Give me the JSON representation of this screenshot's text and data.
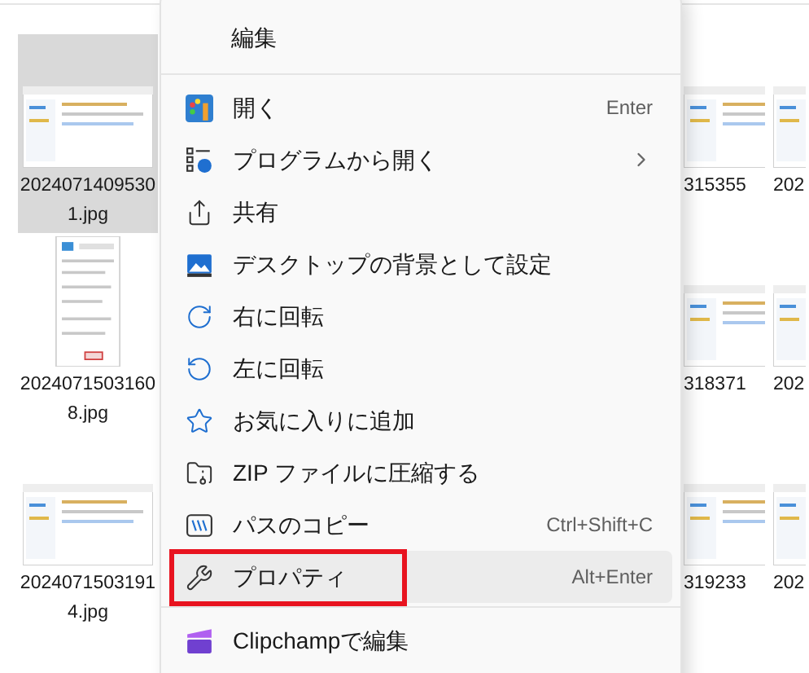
{
  "files": {
    "left": [
      {
        "lines": [
          "2024071409530",
          "1.jpg"
        ],
        "selected": true
      },
      {
        "lines": [
          "2024071503160",
          "8.jpg"
        ],
        "selected": false
      },
      {
        "lines": [
          "2024071503191",
          "4.jpg"
        ],
        "selected": false
      }
    ],
    "right": [
      {
        "lines": [
          "315355"
        ],
        "selected": false
      },
      {
        "lines": [
          "318371"
        ],
        "selected": false
      },
      {
        "lines": [
          "319233"
        ],
        "selected": false
      }
    ],
    "far_right": [
      {
        "lines": [
          "202"
        ],
        "selected": false
      },
      {
        "lines": [
          "202"
        ],
        "selected": false
      },
      {
        "lines": [
          "202"
        ],
        "selected": false
      }
    ]
  },
  "context_menu": {
    "items": [
      {
        "kind": "header",
        "label": "編集"
      },
      {
        "kind": "separator"
      },
      {
        "kind": "item",
        "label": "開く",
        "shortcut": "Enter",
        "hovered": false,
        "annotated": false
      },
      {
        "kind": "item",
        "label": "プログラムから開く",
        "submenu": true,
        "hovered": false,
        "annotated": false
      },
      {
        "kind": "item",
        "label": "共有",
        "hovered": false,
        "annotated": false
      },
      {
        "kind": "item",
        "label": "デスクトップの背景として設定",
        "hovered": false,
        "annotated": false
      },
      {
        "kind": "item",
        "label": "右に回転",
        "hovered": false,
        "annotated": false
      },
      {
        "kind": "item",
        "label": "左に回転",
        "hovered": false,
        "annotated": false
      },
      {
        "kind": "item",
        "label": "お気に入りに追加",
        "hovered": false,
        "annotated": false
      },
      {
        "kind": "item",
        "label": "ZIP ファイルに圧縮する",
        "hovered": false,
        "annotated": false
      },
      {
        "kind": "item",
        "label": "パスのコピー",
        "shortcut": "Ctrl+Shift+C",
        "hovered": false,
        "annotated": false
      },
      {
        "kind": "item",
        "label": "プロパティ",
        "shortcut": "Alt+Enter",
        "hovered": true,
        "annotated": true
      },
      {
        "kind": "separator"
      },
      {
        "kind": "item",
        "label": "Clipchampで編集",
        "hovered": false,
        "annotated": false
      }
    ]
  }
}
